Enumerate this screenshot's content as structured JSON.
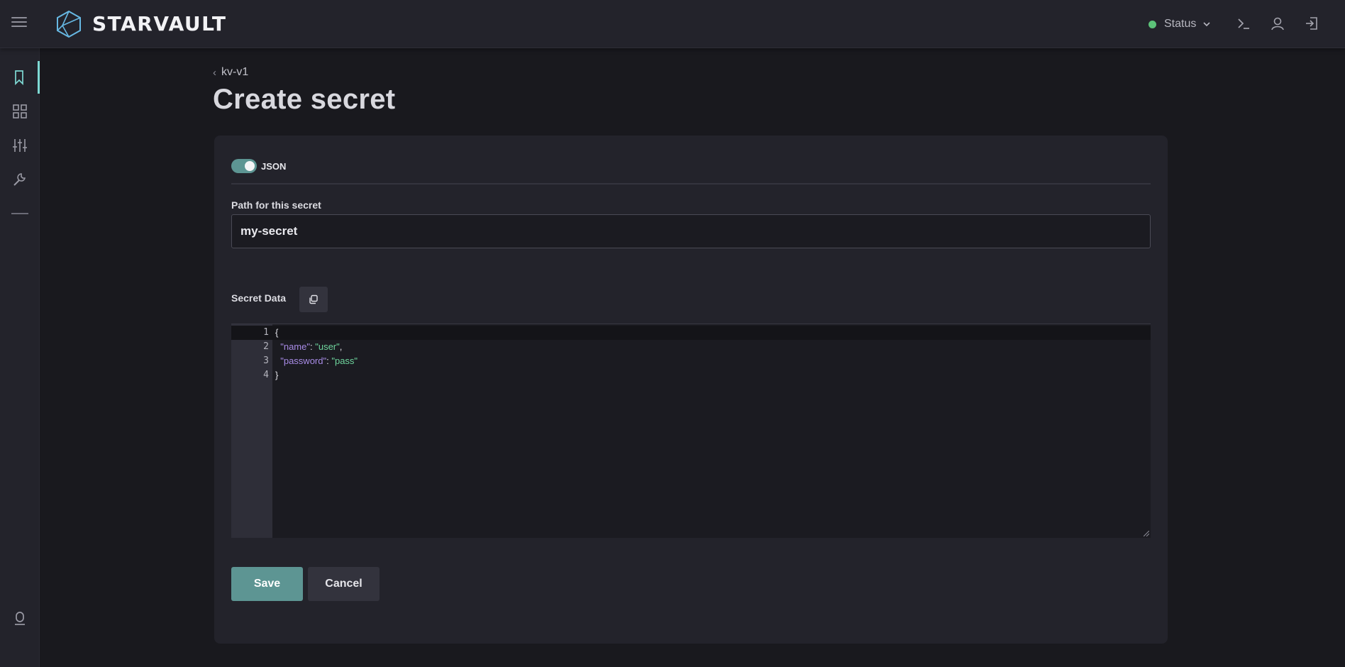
{
  "app": {
    "brand": "STARVAULT",
    "status_label": "Status",
    "status_color": "#5cc279",
    "accent_color": "#7ed9d4",
    "primary_color": "#5d9593"
  },
  "sidebar": {
    "items": [
      {
        "icon": "bookmark-icon",
        "active": true
      },
      {
        "icon": "grid-icon",
        "active": false
      },
      {
        "icon": "sliders-icon",
        "active": false
      },
      {
        "icon": "wrench-icon",
        "active": false
      }
    ]
  },
  "breadcrumb": {
    "label": "kv-v1"
  },
  "page": {
    "title": "Create secret"
  },
  "form": {
    "json_toggle_label": "JSON",
    "json_enabled": true,
    "path_label": "Path for this secret",
    "path_value": "my-secret",
    "secret_data_label": "Secret Data",
    "editor_lines": [
      {
        "num": "1",
        "text": "{"
      },
      {
        "num": "2",
        "key": "\"name\"",
        "sep": ": ",
        "value": "\"user\"",
        "tail": ","
      },
      {
        "num": "3",
        "key": "\"password\"",
        "sep": ": ",
        "value": "\"pass\"",
        "tail": ""
      },
      {
        "num": "4",
        "text": "}"
      }
    ],
    "save_label": "Save",
    "cancel_label": "Cancel"
  }
}
